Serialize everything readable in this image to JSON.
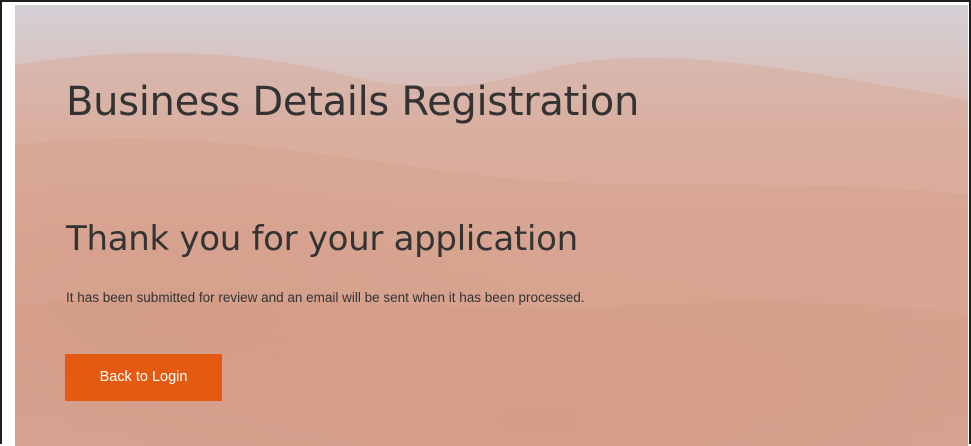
{
  "page": {
    "title": "Business Details Registration",
    "confirmation_heading": "Thank you for your application",
    "confirmation_message": "It has been submitted for review and an email will be sent when it has been processed."
  },
  "actions": {
    "back_to_login_label": "Back to Login"
  },
  "colors": {
    "accent": "#e55a12",
    "text": "#333333",
    "background_sky": "#d4d0d6",
    "background_hill": "#dcae9d"
  }
}
